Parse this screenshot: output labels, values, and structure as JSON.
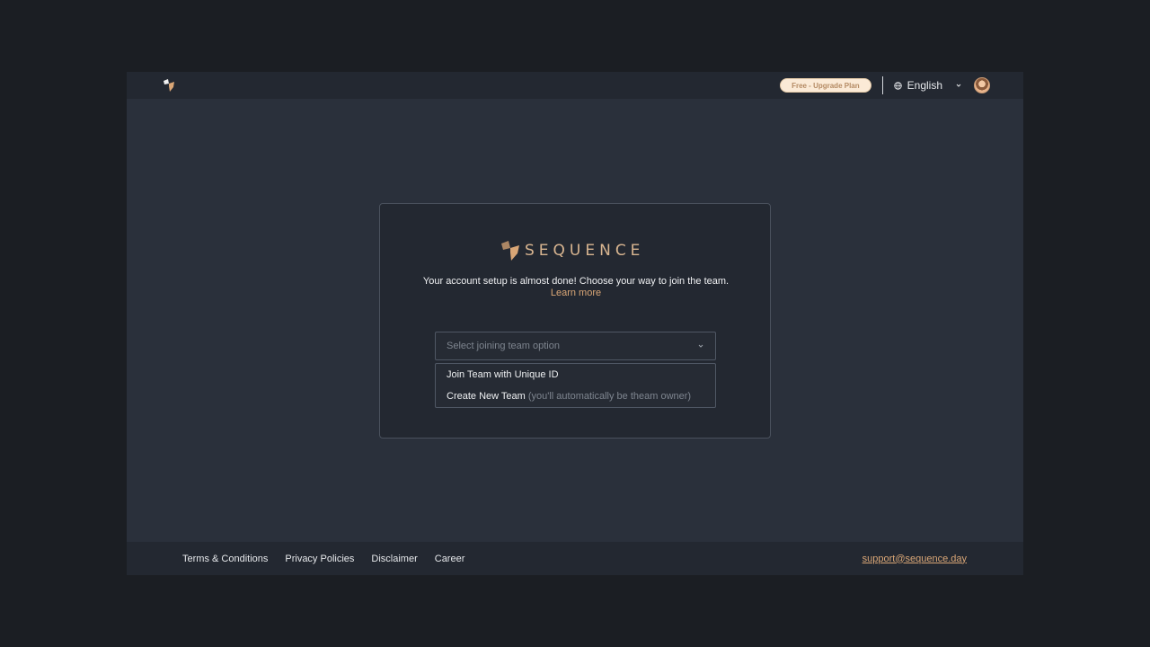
{
  "topbar": {
    "logo_icon": "sequence-logo-icon",
    "plan_badge": "Free - Upgrade Plan",
    "language": "English",
    "globe_icon": "globe-icon",
    "avatar_icon": "user-avatar"
  },
  "card": {
    "brand_name": "SEQUENCE",
    "intro_text": "Your account setup is almost done! Choose your way to join the team.",
    "learn_more": "Learn more",
    "select": {
      "placeholder": "Select joining team option"
    },
    "options": [
      {
        "label": "Join Team with Unique ID",
        "hint": ""
      },
      {
        "label": "Create New Team",
        "hint": "(you'll automatically be theam owner)"
      }
    ]
  },
  "footer": {
    "links": [
      "Terms & Conditions",
      "Privacy Policies",
      "Disclaimer",
      "Career"
    ],
    "email": "support@sequence.day"
  },
  "colors": {
    "accent": "#d9a676",
    "page_bg": "#1b1e23",
    "app_bg": "#2a303b",
    "bar_bg": "#232831"
  }
}
